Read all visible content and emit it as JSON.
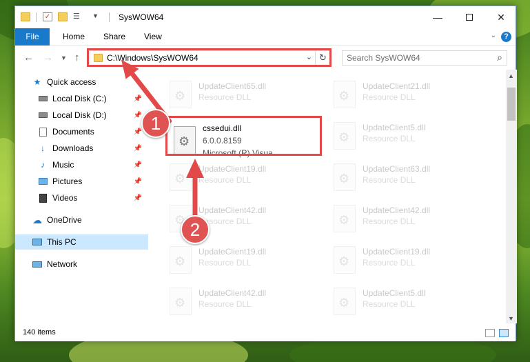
{
  "window": {
    "title": "SysWOW64"
  },
  "ribbon": {
    "tabs": [
      "File",
      "Home",
      "Share",
      "View"
    ],
    "help_label": "?"
  },
  "navigation": {
    "address_path": "C:\\Windows\\SysWOW64",
    "search_placeholder": "Search SysWOW64"
  },
  "sidebar": {
    "items": [
      {
        "label": "Quick access",
        "icon": "star-icon"
      },
      {
        "label": "Local Disk (C:)",
        "icon": "drive-icon"
      },
      {
        "label": "Local Disk (D:)",
        "icon": "drive-icon"
      },
      {
        "label": "Documents",
        "icon": "documents-icon"
      },
      {
        "label": "Downloads",
        "icon": "download-icon"
      },
      {
        "label": "Music",
        "icon": "music-icon"
      },
      {
        "label": "Pictures",
        "icon": "pictures-icon"
      },
      {
        "label": "Videos",
        "icon": "videos-icon"
      },
      {
        "label": "OneDrive",
        "icon": "cloud-icon"
      },
      {
        "label": "This PC",
        "icon": "computer-icon"
      },
      {
        "label": "Network",
        "icon": "network-icon"
      }
    ],
    "selected": "This PC"
  },
  "files": {
    "background_tiles": [
      {
        "name": "UpdateClient65.dll",
        "desc": "Resource DLL"
      },
      {
        "name": "UpdateClient21.dll",
        "desc": "Resource DLL"
      },
      {
        "name": "UpdateClient5.dll",
        "desc": "Resource DLL"
      },
      {
        "name": "UpdateClient19.dll",
        "desc": "Resource DLL"
      },
      {
        "name": "UpdateClient63.dll",
        "desc": "Resource DLL"
      },
      {
        "name": "UpdateClient42.dll",
        "desc": "Resource DLL"
      },
      {
        "name": "UpdateClient42.dll",
        "desc": "Resource DLL"
      },
      {
        "name": "UpdateClient19.dll",
        "desc": "Resource DLL"
      },
      {
        "name": "UpdateClient19.dll",
        "desc": "Resource DLL"
      },
      {
        "name": "UpdateClient42.dll",
        "desc": "Resource DLL"
      },
      {
        "name": "UpdateClient5.dll",
        "desc": "Resource DLL"
      }
    ],
    "highlighted": {
      "name": "cssedui.dll",
      "version": "6.0.0.8159",
      "desc": "Microsoft (R) Visua..."
    }
  },
  "status": {
    "item_count": "140 items"
  },
  "annotations": {
    "step1": "1",
    "step2": "2",
    "color": "#e24a4a"
  },
  "colors": {
    "accent": "#1979ca",
    "selection": "#cce8ff"
  }
}
